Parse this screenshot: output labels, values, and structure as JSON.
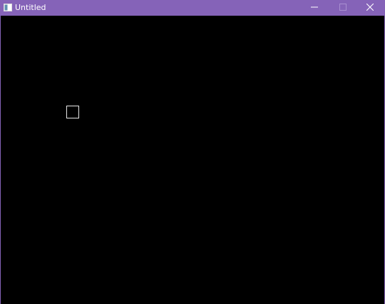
{
  "window": {
    "title": "Untitled",
    "titlebar_color": "#8563b8",
    "client_background": "#000000",
    "icons": {
      "app": "app-window-icon",
      "minimize": "minimize-icon",
      "maximize": "maximize-icon",
      "close": "close-icon"
    }
  },
  "canvas": {
    "shape": "outlined-square",
    "stroke_color": "#e6e6e6"
  }
}
